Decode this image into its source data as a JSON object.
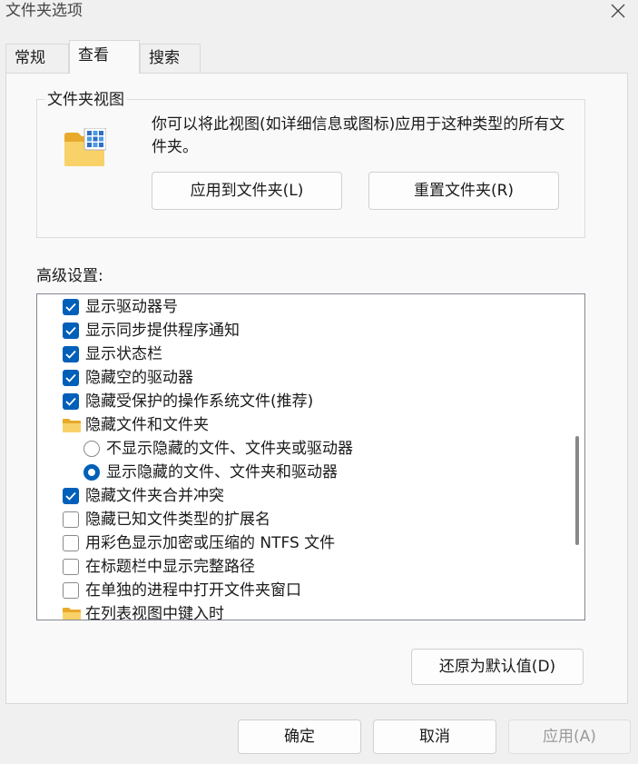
{
  "window": {
    "title": "文件夹选项"
  },
  "tabs": [
    {
      "label": "常规",
      "active": false
    },
    {
      "label": "查看",
      "active": true
    },
    {
      "label": "搜索",
      "active": false
    }
  ],
  "folder_views": {
    "group_title": "文件夹视图",
    "description": "你可以将此视图(如详细信息或图标)应用于这种类型的所有文件夹。",
    "apply_button": "应用到文件夹(L)",
    "reset_button": "重置文件夹(R)"
  },
  "advanced": {
    "label": "高级设置:",
    "items": [
      {
        "type": "checkbox",
        "checked": true,
        "label": "显示驱动器号"
      },
      {
        "type": "checkbox",
        "checked": true,
        "label": "显示同步提供程序通知"
      },
      {
        "type": "checkbox",
        "checked": true,
        "label": "显示状态栏"
      },
      {
        "type": "checkbox",
        "checked": true,
        "label": "隐藏空的驱动器"
      },
      {
        "type": "checkbox",
        "checked": true,
        "label": "隐藏受保护的操作系统文件(推荐)"
      },
      {
        "type": "folder",
        "label": "隐藏文件和文件夹"
      },
      {
        "type": "radio",
        "checked": false,
        "label": "不显示隐藏的文件、文件夹或驱动器"
      },
      {
        "type": "radio",
        "checked": true,
        "label": "显示隐藏的文件、文件夹和驱动器"
      },
      {
        "type": "checkbox",
        "checked": true,
        "label": "隐藏文件夹合并冲突"
      },
      {
        "type": "checkbox",
        "checked": false,
        "label": "隐藏已知文件类型的扩展名"
      },
      {
        "type": "checkbox",
        "checked": false,
        "label": "用彩色显示加密或压缩的 NTFS 文件"
      },
      {
        "type": "checkbox",
        "checked": false,
        "label": "在标题栏中显示完整路径"
      },
      {
        "type": "checkbox",
        "checked": false,
        "label": "在单独的进程中打开文件夹窗口"
      },
      {
        "type": "folder",
        "label": "在列表视图中键入时"
      }
    ],
    "restore_button": "还原为默认值(D)"
  },
  "footer": {
    "ok": "确定",
    "cancel": "取消",
    "apply": "应用(A)"
  },
  "colors": {
    "accent": "#005fb8",
    "folder": "#f5c242",
    "disabled_text": "#9a9a9a"
  }
}
